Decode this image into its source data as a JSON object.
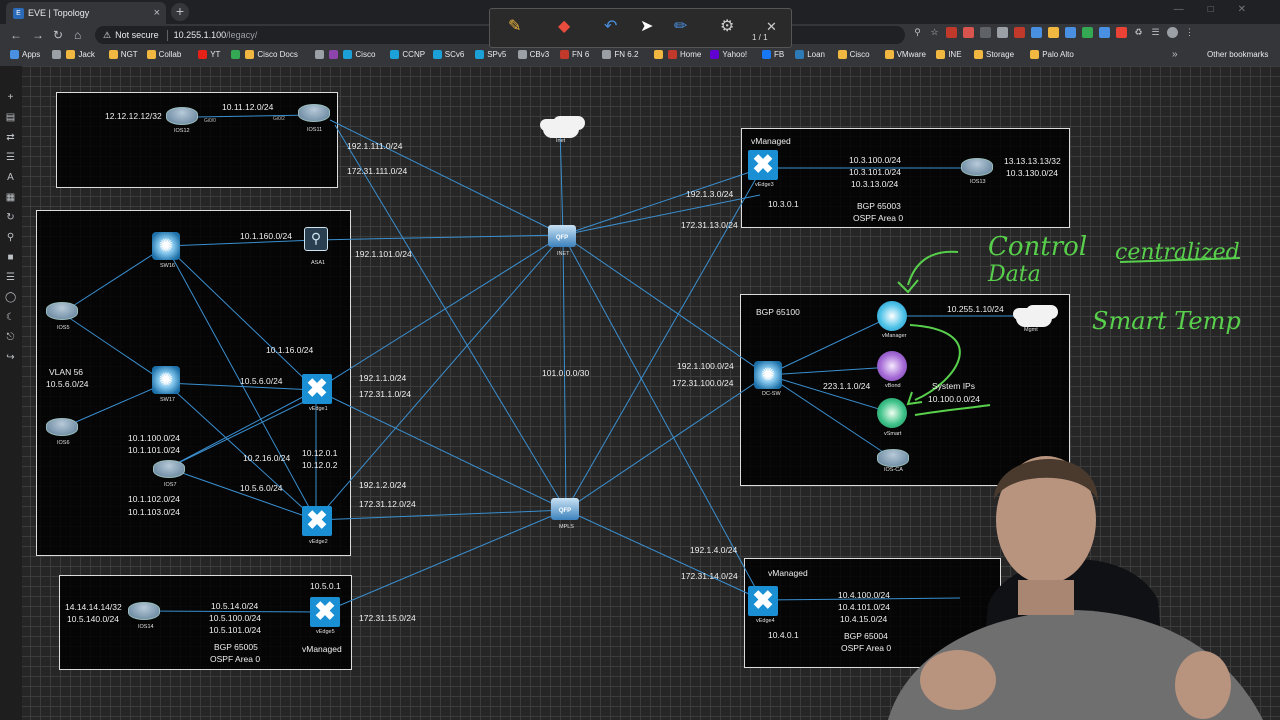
{
  "browser": {
    "tab_title": "EVE | Topology",
    "tab_favicon": "E",
    "tab_close": "×",
    "new_tab": "+",
    "security_label": "Not secure",
    "url_host": "10.255.1.100",
    "url_path": "/legacy/",
    "page_indicator": "1 / 1",
    "bookmarks": [
      {
        "label": "Apps",
        "color": "#4a90e2"
      },
      {
        "label": "",
        "color": "#9aa0a6"
      },
      {
        "label": "Jack",
        "color": "#f0b840"
      },
      {
        "label": "NGT",
        "color": "#f0b840"
      },
      {
        "label": "Collab",
        "color": "#f0b840"
      },
      {
        "label": "YT",
        "color": "#e62117"
      },
      {
        "label": "",
        "color": "#34a853"
      },
      {
        "label": "Cisco Docs",
        "color": "#f0b840"
      },
      {
        "label": "",
        "color": "#9aa0a6"
      },
      {
        "label": "",
        "color": "#8e44ad"
      },
      {
        "label": "Cisco",
        "color": "#1ba0d7"
      },
      {
        "label": "CCNP",
        "color": "#1ba0d7"
      },
      {
        "label": "SCv6",
        "color": "#1ba0d7"
      },
      {
        "label": "SPv5",
        "color": "#1ba0d7"
      },
      {
        "label": "CBv3",
        "color": "#9aa0a6"
      },
      {
        "label": "FN 6",
        "color": "#c0392b"
      },
      {
        "label": "FN 6.2",
        "color": "#9aa0a6"
      },
      {
        "label": "",
        "color": "#f0b840"
      },
      {
        "label": "Home",
        "color": "#c0392b"
      },
      {
        "label": "Yahoo!",
        "color": "#6001d2"
      },
      {
        "label": "FB",
        "color": "#1877f2"
      },
      {
        "label": "Loan",
        "color": "#2c7bb6"
      },
      {
        "label": "Cisco",
        "color": "#f0b840"
      },
      {
        "label": "VMware",
        "color": "#f0b840"
      },
      {
        "label": "INE",
        "color": "#f0b840"
      },
      {
        "label": "Storage",
        "color": "#f0b840"
      },
      {
        "label": "Palo Alto",
        "color": "#f0b840"
      }
    ],
    "bookmarks_more": "»",
    "other_bookmarks": "Other bookmarks"
  },
  "topology": {
    "box1": {
      "ip_ios12": "12.12.12.12/32",
      "subnet": "10.11.12.0/24",
      "ios12": "IOS12",
      "ios11": "IOS11"
    },
    "box2": {
      "sw16": "SW16",
      "asa1": "ASA1",
      "sw17": "SW17",
      "ios5": "IOS5",
      "ios6": "IOS6",
      "ios7": "IOS7",
      "vedge1": "vEdge1",
      "vedge2": "vEdge2",
      "vlan": "VLAN 56",
      "vlan_net": "10.5.6.0/24",
      "n_160": "10.1.160.0/24",
      "n_116": "10.1.16.0/24",
      "n_56": "10.5.6.0/24",
      "n_100": "10.1.100.0/24",
      "n_101": "10.1.101.0/24",
      "n_102": "10.1.102.0/24",
      "n_103": "10.1.103.0/24",
      "n_216": "10.2.16.0/24",
      "n_12a": "10.12.0.1",
      "n_12b": "10.12.0.2",
      "n_56b": "10.5.6.0/24"
    },
    "box3": {
      "title": "vManaged",
      "vedge3": "vEdge3",
      "ios13": "IOS13",
      "n_100": "10.3.100.0/24",
      "n_101": "10.3.101.0/24",
      "n_13": "10.3.13.0/24",
      "lo": "13.13.13.13/32",
      "n_130": "10.3.130.0/24",
      "sys": "10.3.0.1",
      "bgp": "BGP 65003",
      "ospf": "OSPF Area 0"
    },
    "box4": {
      "bgp": "BGP 65100",
      "vmanager": "vManager",
      "vbond": "vBond",
      "vsmart": "vSmart",
      "ioscа": "IOS-CA",
      "dcsw": "DC-SW",
      "mgmt": "Mgmt",
      "n_mgmt": "10.255.1.10/24",
      "n_223": "223.1.1.0/24",
      "sys_title": "System IPs",
      "sys_net": "10.100.0.0/24"
    },
    "box5": {
      "title": "vManaged",
      "vedge4": "vEdge4",
      "n_100": "10.4.100.0/24",
      "n_101": "10.4.101.0/24",
      "n_15": "10.4.15.0/24",
      "sys": "10.4.0.1",
      "bgp": "BGP 65004",
      "ospf": "OSPF Area 0"
    },
    "box6": {
      "lo": "14.14.14.14/32",
      "n_140": "10.5.140.0/24",
      "ios14": "IOS14",
      "vedge5": "vEdge5",
      "n_14": "10.5.14.0/24",
      "n_100": "10.5.100.0/24",
      "n_101": "10.5.101.0/24",
      "sys": "10.5.0.1",
      "bgp": "BGP 65005",
      "ospf": "OSPF Area 0",
      "title": "vManaged"
    },
    "core": {
      "inet": "INET",
      "mpls": "MPLS",
      "qfp": "QFP",
      "n_101": "101.0.0.0/30"
    },
    "links": {
      "l_111_192": "192.1.111.0/24",
      "l_111_172": "172.31.111.0/24",
      "l_101_192": "192.1.101.0/24",
      "l_13_192": "192.1.3.0/24",
      "l_13_172": "172.31.13.0/24",
      "l_1_192": "192.1.1.0/24",
      "l_1_172": "172.31.1.0/24",
      "l_100_192": "192.1.100.0/24",
      "l_100_172": "172.31.100.0/24",
      "l_2_192": "192.1.2.0/24",
      "l_12_172": "172.31.12.0/24",
      "l_4_192": "192.1.4.0/24",
      "l_14_172": "172.31.14.0/24",
      "l_15_172": "172.31.15.0/24"
    }
  },
  "annotations": {
    "control": "Control",
    "data": "Data",
    "centralized": "centralized",
    "smart_temp": "Smart Temp"
  }
}
